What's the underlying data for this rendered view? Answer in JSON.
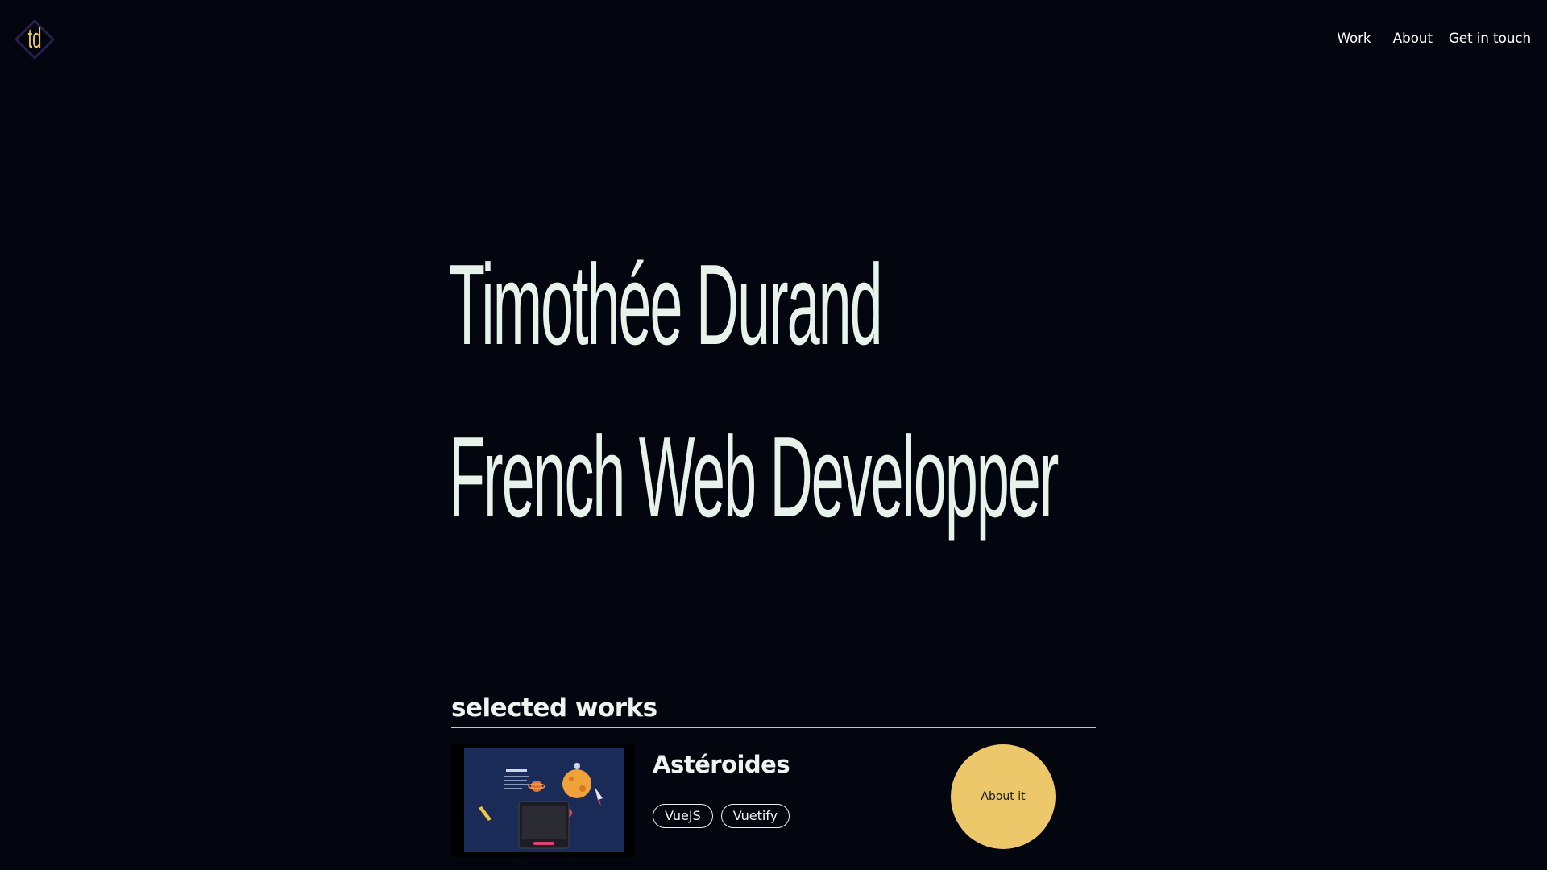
{
  "header": {
    "logo_text": "td",
    "nav": [
      {
        "label": "Work"
      },
      {
        "label": "About"
      },
      {
        "label": "Get in touch"
      }
    ]
  },
  "hero": {
    "name": "Timothée Durand",
    "role": "French Web Developper"
  },
  "works": {
    "heading": "selected works",
    "items": [
      {
        "title": "Astéroides",
        "tags": [
          "VueJS",
          "Vuetify"
        ],
        "cta": "About it"
      }
    ]
  },
  "colors": {
    "background": "#03050f",
    "text": "#e6f2ea",
    "accent": "#ecc86a",
    "logo_diamond": "#2a1f4a"
  }
}
